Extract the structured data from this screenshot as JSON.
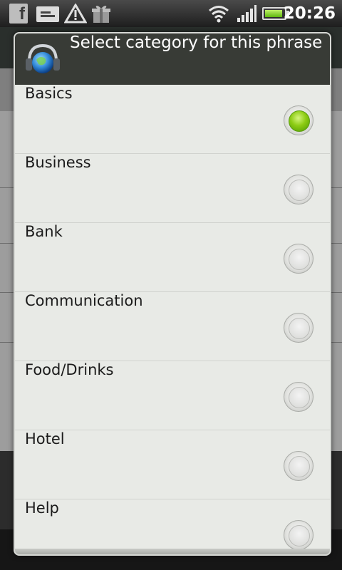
{
  "status_bar": {
    "time": "20:26",
    "icons": [
      "facebook-icon",
      "message-icon",
      "warning-icon",
      "gift-icon",
      "wifi-icon",
      "signal-icon",
      "battery-icon"
    ]
  },
  "dialog": {
    "title": "Select category for this phrase",
    "icon": "headset-globe-icon",
    "selected_index": 0,
    "options": [
      {
        "label": "Basics",
        "checked": true
      },
      {
        "label": "Business",
        "checked": false
      },
      {
        "label": "Bank",
        "checked": false
      },
      {
        "label": "Communication",
        "checked": false
      },
      {
        "label": "Food/Drinks",
        "checked": false
      },
      {
        "label": "Hotel",
        "checked": false
      },
      {
        "label": "Help",
        "checked": false
      }
    ]
  },
  "colors": {
    "accent_green": "#8dcc14",
    "header_bg": "#383b36",
    "list_bg": "#e8eae6"
  }
}
